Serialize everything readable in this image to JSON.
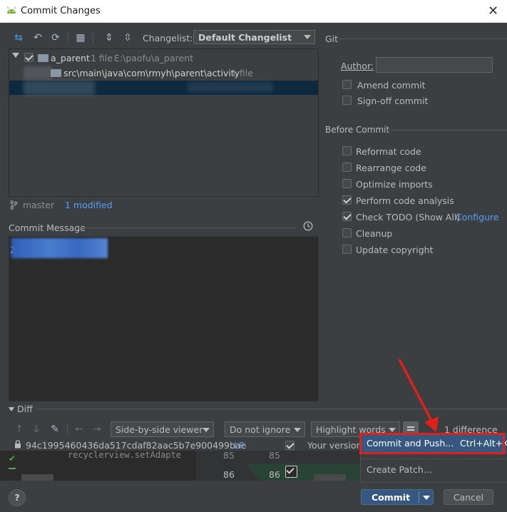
{
  "window": {
    "title": "Commit Changes",
    "close_glyph": "✕"
  },
  "toolbar": {
    "changelist_label": "Changelist:",
    "changelist_value": "Default Changelist"
  },
  "tree": {
    "root_label": "a_parent",
    "root_count": "1 file",
    "root_path": "E:\\paofu\\a_parent",
    "child_label": "src\\main\\java\\com\\rmyh\\parent\\activity",
    "child_count": "1 file"
  },
  "branch": {
    "name": "master",
    "modified": "1 modified"
  },
  "commit_message": {
    "label": "Commit Message",
    "text": "2"
  },
  "git": {
    "section_label": "Git",
    "author_label": "Author:",
    "author_value": "",
    "options": [
      {
        "label": "Amend commit",
        "checked": false
      },
      {
        "label": "Sign-off commit",
        "checked": false
      }
    ]
  },
  "before_commit": {
    "section_label": "Before Commit",
    "options": [
      {
        "label": "Reformat code",
        "checked": false
      },
      {
        "label": "Rearrange code",
        "checked": false
      },
      {
        "label": "Optimize imports",
        "checked": false
      },
      {
        "label": "Perform code analysis",
        "checked": true
      },
      {
        "label": "Check TODO (Show All)",
        "checked": true,
        "link": "Configure"
      },
      {
        "label": "Cleanup",
        "checked": false
      },
      {
        "label": "Update copyright",
        "checked": false
      }
    ]
  },
  "diff": {
    "section_label": "Diff",
    "viewer": "Side-by-side viewer",
    "ignore": "Do not ignore",
    "highlight": "Highlight words",
    "differences": "1 difference",
    "hash": "94c1995460436da517cdaf82aac5b7e900499bae",
    "line_sep": "LF",
    "your_version": "Your version",
    "code_line": "recyclerview.setAdapte",
    "left_line_numbers": [
      "85",
      "86"
    ],
    "right_line_numbers": [
      "85",
      "86"
    ]
  },
  "dropdown": {
    "commit_and_push": "Commit and Push...",
    "commit_and_push_shortcut": "Ctrl+Alt+K",
    "create_patch": "Create Patch..."
  },
  "footer": {
    "help": "?",
    "commit": "Commit",
    "cancel": "Cancel"
  },
  "colors": {
    "accent": "#365880",
    "highlight_red": "#e0201a",
    "selection": "#0d293e",
    "diff_green": "#294436"
  }
}
